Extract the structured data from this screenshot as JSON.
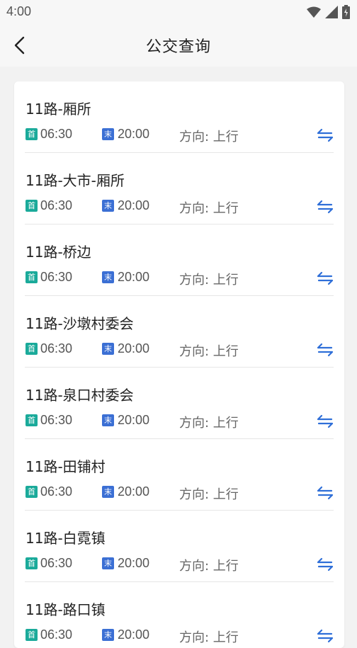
{
  "status_bar": {
    "time": "4:00",
    "icons": [
      "wifi-icon",
      "signal-icon",
      "battery-icon"
    ]
  },
  "header": {
    "title": "公交查询",
    "back_icon": "back-arrow-icon"
  },
  "routes": [
    {
      "name": "11路-厢所",
      "first_tag": "首",
      "first_time": "06:30",
      "last_tag": "末",
      "last_time": "20:00",
      "direction": "方向: 上行"
    },
    {
      "name": "11路-大市-厢所",
      "first_tag": "首",
      "first_time": "06:30",
      "last_tag": "末",
      "last_time": "20:00",
      "direction": "方向: 上行"
    },
    {
      "name": "11路-桥边",
      "first_tag": "首",
      "first_time": "06:30",
      "last_tag": "末",
      "last_time": "20:00",
      "direction": "方向: 上行"
    },
    {
      "name": "11路-沙墩村委会",
      "first_tag": "首",
      "first_time": "06:30",
      "last_tag": "末",
      "last_time": "20:00",
      "direction": "方向: 上行"
    },
    {
      "name": "11路-泉口村委会",
      "first_tag": "首",
      "first_time": "06:30",
      "last_tag": "末",
      "last_time": "20:00",
      "direction": "方向: 上行"
    },
    {
      "name": "11路-田铺村",
      "first_tag": "首",
      "first_time": "06:30",
      "last_tag": "末",
      "last_time": "20:00",
      "direction": "方向: 上行"
    },
    {
      "name": "11路-白霓镇",
      "first_tag": "首",
      "first_time": "06:30",
      "last_tag": "末",
      "last_time": "20:00",
      "direction": "方向: 上行"
    },
    {
      "name": "11路-路口镇",
      "first_tag": "首",
      "first_time": "06:30",
      "last_tag": "末",
      "last_time": "20:00",
      "direction": "方向: 上行"
    }
  ],
  "colors": {
    "first_tag": "#1aaa9a",
    "last_tag": "#3b6fd4",
    "swap_icon": "#2f6fd8",
    "background": "#f2f2f2"
  }
}
